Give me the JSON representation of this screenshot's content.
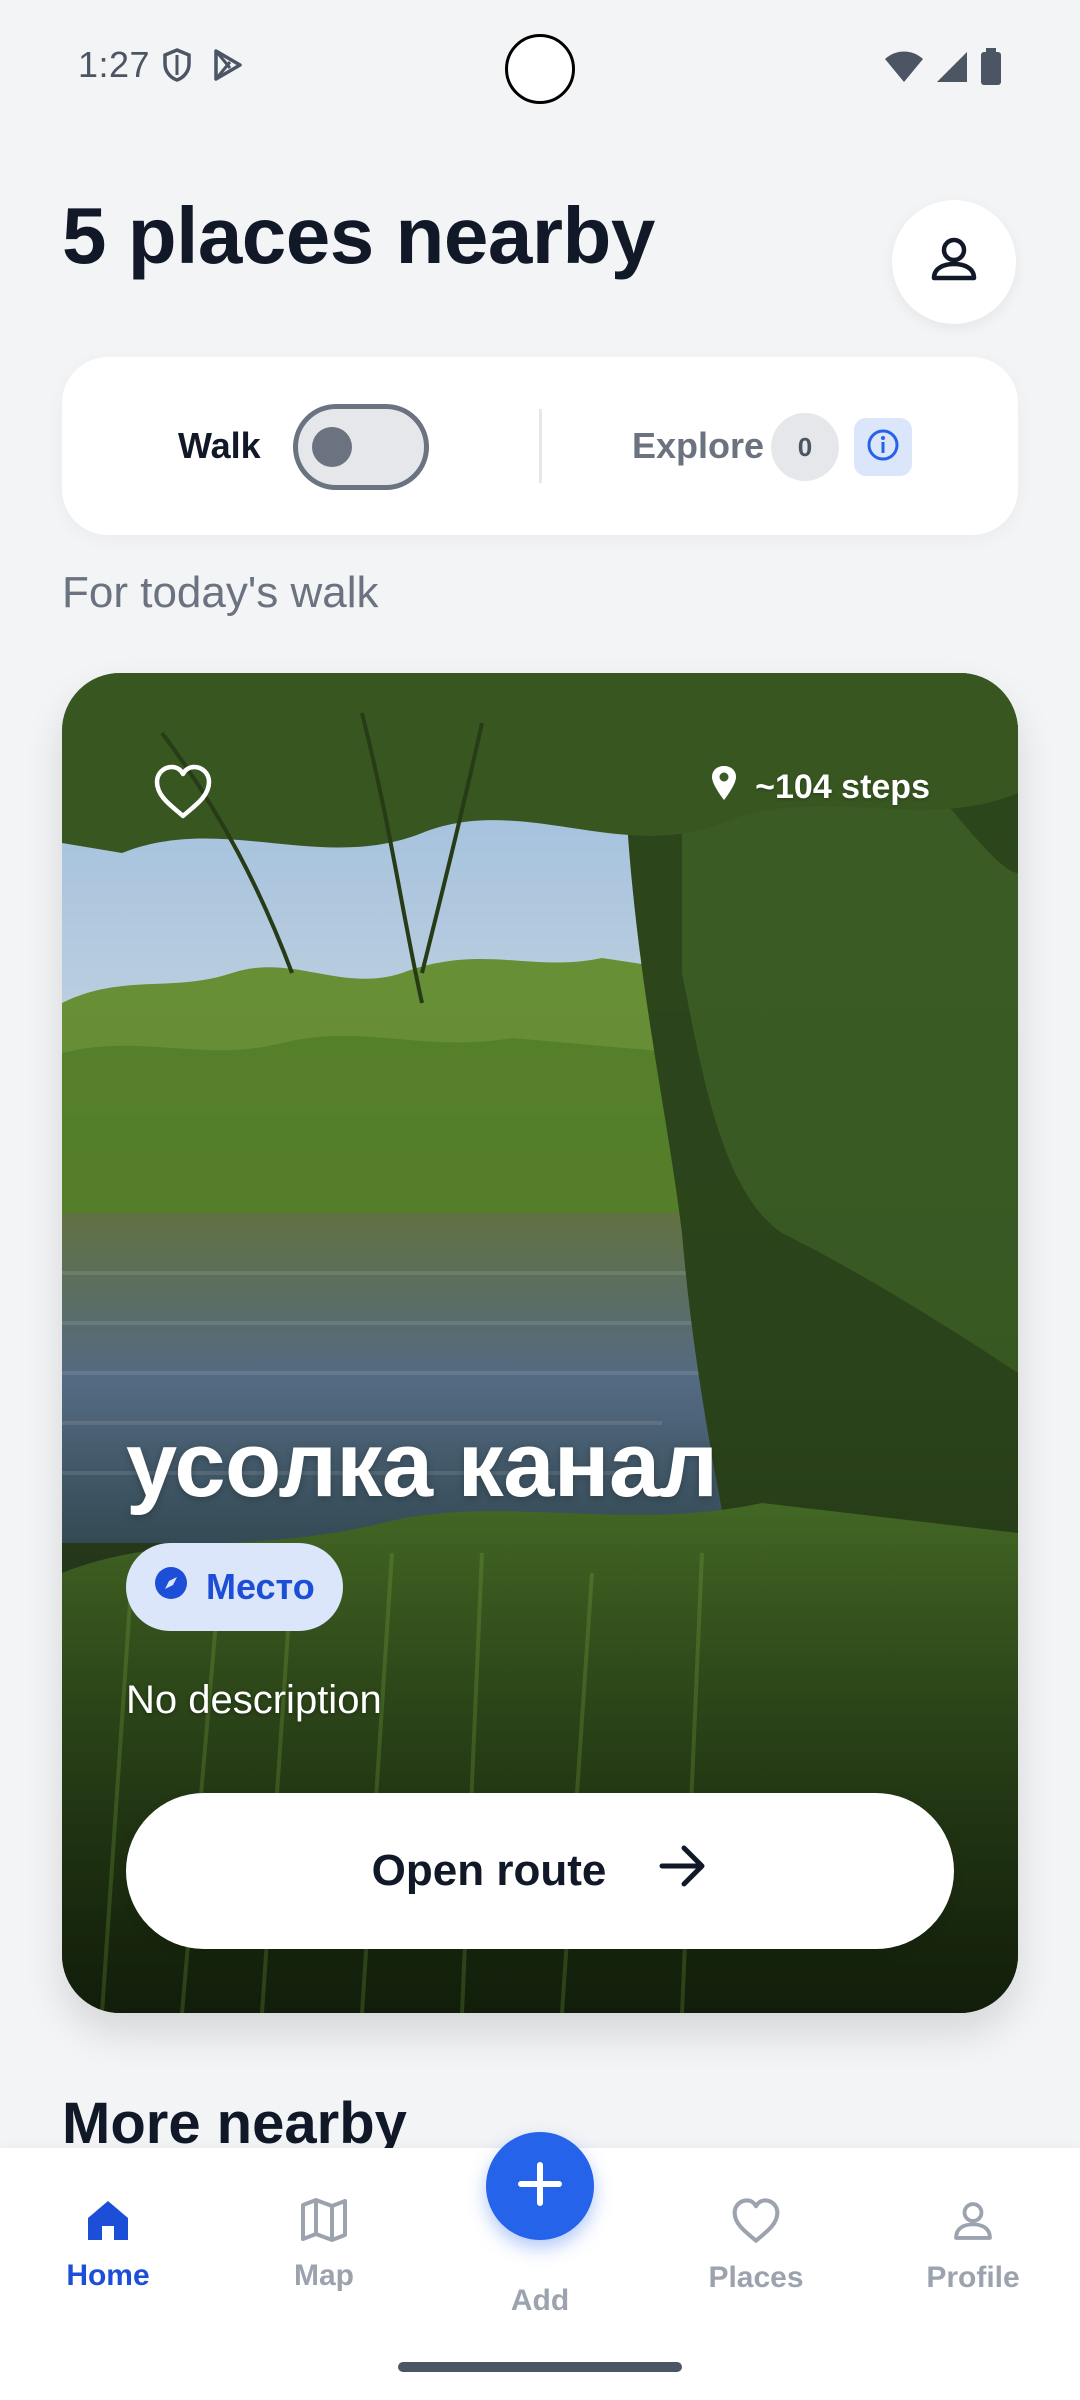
{
  "status_bar": {
    "time": "1:27",
    "left_icons": [
      "shield-icon",
      "play-store-icon"
    ],
    "right_icons": [
      "wifi-icon",
      "signal-icon",
      "battery-icon"
    ]
  },
  "header": {
    "title": "5 places nearby",
    "profile_icon": "person-icon"
  },
  "mode_card": {
    "walk_label": "Walk",
    "walk_enabled": false,
    "explore_label": "Explore",
    "explore_count": "0",
    "info_icon": "info-icon"
  },
  "section": {
    "subtitle": "For today's walk",
    "more_heading": "More nearby"
  },
  "featured_place": {
    "title": "усолка канал",
    "steps": "~104 steps",
    "category": "Место",
    "description": "No description",
    "open_route_label": "Open route",
    "favorite_icon": "heart-outline-icon",
    "pin_icon": "map-pin-icon",
    "category_icon": "compass-icon",
    "arrow_icon": "arrow-right-icon"
  },
  "bottom_nav": {
    "items": [
      {
        "label": "Home",
        "icon": "home-icon",
        "active": true
      },
      {
        "label": "Map",
        "icon": "map-icon",
        "active": false
      },
      {
        "label": "Add",
        "icon": "plus-icon",
        "active": false
      },
      {
        "label": "Places",
        "icon": "heart-outline-icon",
        "active": false
      },
      {
        "label": "Profile",
        "icon": "person-icon",
        "active": false
      }
    ]
  },
  "colors": {
    "accent": "#2563eb",
    "accent_soft": "#dbe6fb",
    "background": "#f3f4f6",
    "text_primary": "#111827",
    "text_muted": "#6b7280"
  }
}
